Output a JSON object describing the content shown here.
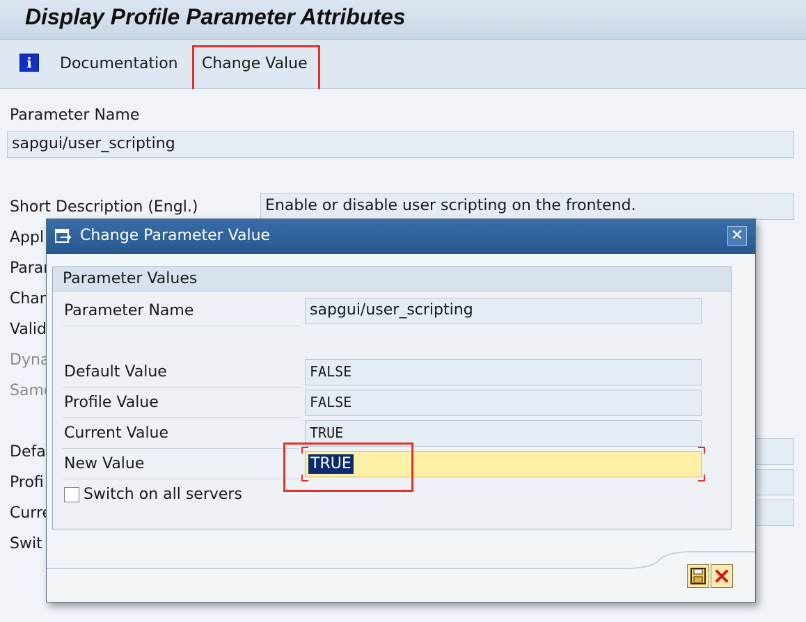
{
  "window": {
    "title": "Display Profile Parameter Attributes"
  },
  "toolbar": {
    "info_icon_glyph": "i",
    "documentation_label": "Documentation",
    "change_value_label": "Change Value"
  },
  "background_form": {
    "parameter_name_label": "Parameter Name",
    "parameter_name_value": "sapgui/user_scripting",
    "short_description_label": "Short Description (Engl.)",
    "short_description_value": "Enable or disable user scripting on the frontend.",
    "partial_labels": [
      "Appl",
      "Parar",
      "Chan",
      "Valid",
      "Dyna",
      "Same",
      "Defa",
      "Profi",
      "Curre",
      "Swit"
    ]
  },
  "dialog": {
    "title": "Change Parameter Value",
    "group_title": "Parameter Values",
    "parameter_name_label": "Parameter Name",
    "parameter_name_value": "sapgui/user_scripting",
    "default_value_label": "Default Value",
    "default_value": "FALSE",
    "profile_value_label": "Profile Value",
    "profile_value": "FALSE",
    "current_value_label": "Current Value",
    "current_value": "TRUE",
    "new_value_label": "New Value",
    "new_value": "TRUE",
    "switch_all_servers_label": "Switch on all servers",
    "switch_all_servers_checked": false,
    "close_glyph": "✕"
  },
  "colors": {
    "highlight": "#e8302a",
    "dialog_title_bg": "#26578f",
    "new_value_bg": "#fff1a8",
    "selection_bg": "#0a2a70"
  },
  "icons": [
    "info-icon",
    "change-dialog-icon",
    "close-icon",
    "save-icon",
    "cancel-icon"
  ]
}
